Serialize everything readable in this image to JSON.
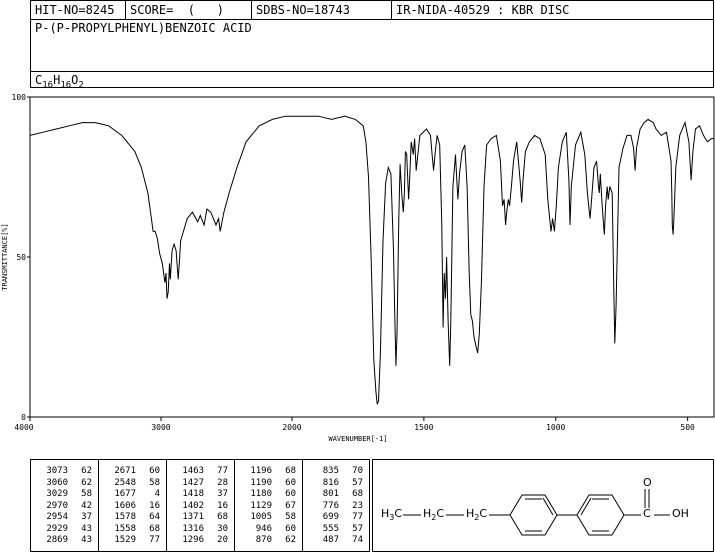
{
  "header": {
    "hit_no": "HIT-NO=8245",
    "score": "SCORE=  (   )",
    "sdbs_no": "SDBS-NO=18743",
    "ir_nida": "IR-NIDA-40529 : KBR DISC",
    "compound_name": "P-(P-PROPYLPHENYL)BENZOIC ACID",
    "formula_parts": [
      [
        "C",
        "16"
      ],
      [
        "H",
        "16"
      ],
      [
        "O",
        "2"
      ]
    ]
  },
  "chart_data": {
    "type": "line",
    "title": "",
    "xlabel": "WAVENUMBER[-1]",
    "ylabel": "TRANSMITTANCE[%]",
    "xlim": [
      4000,
      400
    ],
    "ylim": [
      0,
      100
    ],
    "x_ticks": [
      4000,
      3000,
      2000,
      1500,
      1000,
      500
    ],
    "y_ticks": [
      0,
      50,
      100
    ],
    "grid": false,
    "series": [
      {
        "name": "",
        "color": "#000000",
        "points": [
          [
            4000,
            88
          ],
          [
            3900,
            89
          ],
          [
            3800,
            90
          ],
          [
            3700,
            91
          ],
          [
            3600,
            92
          ],
          [
            3500,
            92
          ],
          [
            3400,
            91
          ],
          [
            3300,
            88
          ],
          [
            3200,
            83
          ],
          [
            3150,
            78
          ],
          [
            3100,
            70
          ],
          [
            3080,
            64
          ],
          [
            3073,
            62
          ],
          [
            3060,
            58
          ],
          [
            3045,
            58
          ],
          [
            3029,
            56
          ],
          [
            3010,
            51
          ],
          [
            2990,
            48
          ],
          [
            2970,
            42
          ],
          [
            2962,
            45
          ],
          [
            2954,
            37
          ],
          [
            2945,
            39
          ],
          [
            2935,
            48
          ],
          [
            2929,
            43
          ],
          [
            2915,
            52
          ],
          [
            2900,
            54
          ],
          [
            2885,
            52
          ],
          [
            2869,
            43
          ],
          [
            2860,
            48
          ],
          [
            2850,
            55
          ],
          [
            2800,
            62
          ],
          [
            2760,
            64
          ],
          [
            2720,
            61
          ],
          [
            2700,
            63
          ],
          [
            2671,
            60
          ],
          [
            2650,
            65
          ],
          [
            2620,
            64
          ],
          [
            2600,
            62
          ],
          [
            2580,
            60
          ],
          [
            2560,
            62
          ],
          [
            2548,
            58
          ],
          [
            2520,
            64
          ],
          [
            2480,
            70
          ],
          [
            2420,
            78
          ],
          [
            2350,
            86
          ],
          [
            2250,
            91
          ],
          [
            2150,
            93
          ],
          [
            2050,
            94
          ],
          [
            1950,
            94
          ],
          [
            1900,
            94
          ],
          [
            1850,
            93
          ],
          [
            1800,
            94
          ],
          [
            1760,
            93
          ],
          [
            1730,
            91
          ],
          [
            1720,
            86
          ],
          [
            1710,
            75
          ],
          [
            1700,
            50
          ],
          [
            1690,
            18
          ],
          [
            1682,
            8
          ],
          [
            1677,
            4
          ],
          [
            1672,
            5
          ],
          [
            1665,
            20
          ],
          [
            1655,
            55
          ],
          [
            1645,
            73
          ],
          [
            1635,
            78
          ],
          [
            1625,
            76
          ],
          [
            1615,
            52
          ],
          [
            1610,
            30
          ],
          [
            1606,
            16
          ],
          [
            1602,
            26
          ],
          [
            1595,
            62
          ],
          [
            1590,
            79
          ],
          [
            1584,
            70
          ],
          [
            1578,
            64
          ],
          [
            1574,
            70
          ],
          [
            1570,
            83
          ],
          [
            1565,
            82
          ],
          [
            1558,
            68
          ],
          [
            1554,
            74
          ],
          [
            1548,
            86
          ],
          [
            1540,
            82
          ],
          [
            1535,
            87
          ],
          [
            1529,
            77
          ],
          [
            1524,
            81
          ],
          [
            1515,
            88
          ],
          [
            1490,
            90
          ],
          [
            1475,
            88
          ],
          [
            1469,
            82
          ],
          [
            1463,
            77
          ],
          [
            1458,
            82
          ],
          [
            1450,
            88
          ],
          [
            1440,
            85
          ],
          [
            1432,
            60
          ],
          [
            1427,
            28
          ],
          [
            1423,
            45
          ],
          [
            1418,
            37
          ],
          [
            1414,
            50
          ],
          [
            1408,
            30
          ],
          [
            1402,
            16
          ],
          [
            1398,
            30
          ],
          [
            1390,
            72
          ],
          [
            1380,
            82
          ],
          [
            1375,
            74
          ],
          [
            1371,
            68
          ],
          [
            1365,
            76
          ],
          [
            1355,
            83
          ],
          [
            1345,
            85
          ],
          [
            1336,
            72
          ],
          [
            1328,
            45
          ],
          [
            1322,
            32
          ],
          [
            1316,
            30
          ],
          [
            1310,
            25
          ],
          [
            1302,
            22
          ],
          [
            1296,
            20
          ],
          [
            1290,
            26
          ],
          [
            1282,
            42
          ],
          [
            1272,
            72
          ],
          [
            1262,
            85
          ],
          [
            1245,
            87
          ],
          [
            1225,
            88
          ],
          [
            1210,
            80
          ],
          [
            1202,
            66
          ],
          [
            1196,
            68
          ],
          [
            1190,
            60
          ],
          [
            1186,
            64
          ],
          [
            1180,
            68
          ],
          [
            1175,
            66
          ],
          [
            1168,
            72
          ],
          [
            1160,
            80
          ],
          [
            1148,
            86
          ],
          [
            1135,
            74
          ],
          [
            1129,
            67
          ],
          [
            1124,
            74
          ],
          [
            1115,
            83
          ],
          [
            1100,
            86
          ],
          [
            1080,
            88
          ],
          [
            1060,
            87
          ],
          [
            1040,
            82
          ],
          [
            1030,
            68
          ],
          [
            1018,
            58
          ],
          [
            1012,
            62
          ],
          [
            1005,
            58
          ],
          [
            998,
            66
          ],
          [
            990,
            78
          ],
          [
            975,
            86
          ],
          [
            960,
            89
          ],
          [
            950,
            74
          ],
          [
            946,
            60
          ],
          [
            941,
            72
          ],
          [
            925,
            85
          ],
          [
            905,
            89
          ],
          [
            890,
            82
          ],
          [
            880,
            70
          ],
          [
            870,
            62
          ],
          [
            866,
            66
          ],
          [
            855,
            78
          ],
          [
            845,
            80
          ],
          [
            838,
            72
          ],
          [
            835,
            70
          ],
          [
            831,
            76
          ],
          [
            823,
            65
          ],
          [
            816,
            57
          ],
          [
            811,
            66
          ],
          [
            805,
            72
          ],
          [
            801,
            68
          ],
          [
            795,
            72
          ],
          [
            786,
            70
          ],
          [
            780,
            40
          ],
          [
            776,
            23
          ],
          [
            771,
            35
          ],
          [
            760,
            78
          ],
          [
            745,
            84
          ],
          [
            730,
            88
          ],
          [
            715,
            88
          ],
          [
            705,
            84
          ],
          [
            699,
            77
          ],
          [
            694,
            84
          ],
          [
            680,
            90
          ],
          [
            665,
            92
          ],
          [
            650,
            93
          ],
          [
            630,
            92
          ],
          [
            620,
            90
          ],
          [
            600,
            88
          ],
          [
            580,
            89
          ],
          [
            563,
            80
          ],
          [
            560,
            70
          ],
          [
            558,
            60
          ],
          [
            555,
            57
          ],
          [
            552,
            62
          ],
          [
            545,
            78
          ],
          [
            530,
            88
          ],
          [
            510,
            92
          ],
          [
            495,
            86
          ],
          [
            487,
            74
          ],
          [
            480,
            83
          ],
          [
            470,
            90
          ],
          [
            455,
            91
          ],
          [
            440,
            88
          ],
          [
            425,
            86
          ],
          [
            410,
            87
          ],
          [
            400,
            87
          ]
        ]
      }
    ]
  },
  "peak_table": [
    [
      [
        3073,
        62
      ],
      [
        3060,
        62
      ],
      [
        3029,
        58
      ],
      [
        2970,
        42
      ],
      [
        2954,
        37
      ],
      [
        2929,
        43
      ],
      [
        2869,
        43
      ]
    ],
    [
      [
        2671,
        60
      ],
      [
        2548,
        58
      ],
      [
        1677,
        4
      ],
      [
        1606,
        16
      ],
      [
        1578,
        64
      ],
      [
        1558,
        68
      ],
      [
        1529,
        77
      ]
    ],
    [
      [
        1463,
        77
      ],
      [
        1427,
        28
      ],
      [
        1418,
        37
      ],
      [
        1402,
        16
      ],
      [
        1371,
        68
      ],
      [
        1316,
        30
      ],
      [
        1296,
        20
      ]
    ],
    [
      [
        1196,
        68
      ],
      [
        1190,
        60
      ],
      [
        1180,
        60
      ],
      [
        1129,
        67
      ],
      [
        1005,
        58
      ],
      [
        946,
        60
      ],
      [
        870,
        62
      ]
    ],
    [
      [
        835,
        70
      ],
      [
        816,
        57
      ],
      [
        801,
        68
      ],
      [
        776,
        23
      ],
      [
        699,
        77
      ],
      [
        555,
        57
      ],
      [
        487,
        74
      ]
    ]
  ],
  "structure": {
    "ch3_main": "H",
    "ch3_sub": "3",
    "ch3_tail": "C",
    "ch2a_main": "H",
    "ch2a_sub": "2",
    "ch2a_tail": "C",
    "ch2b_main": "H",
    "ch2b_sub": "2",
    "ch2b_tail": "C",
    "carbonyl_o": "O",
    "carbonyl_c": "C",
    "hydroxyl": "OH"
  }
}
